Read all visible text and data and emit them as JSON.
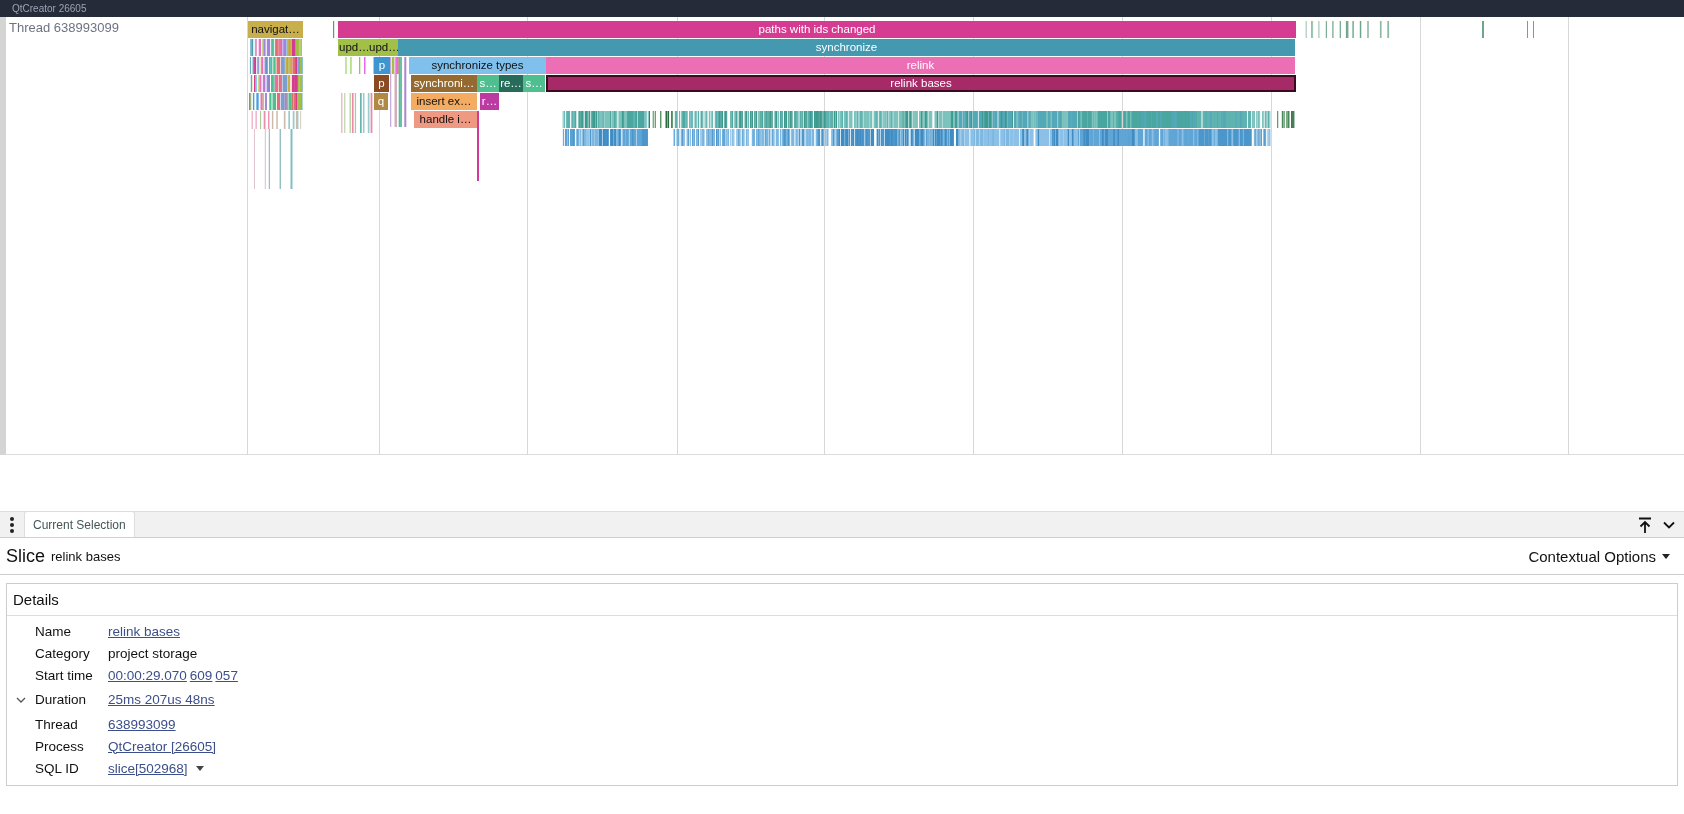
{
  "window": {
    "title": "QtCreator 26605"
  },
  "track": {
    "title": "Thread 638993099",
    "slices": [
      {
        "label": "navigat…",
        "color": "#c8af4b",
        "selected": false
      },
      {
        "label": "paths with ids changed",
        "color": "#d63b92",
        "selected": false
      },
      {
        "label": "upd…",
        "color": "#a2bf48",
        "selected": false
      },
      {
        "label": "upd…",
        "color": "#a2bf48",
        "selected": false
      },
      {
        "label": "synchronize",
        "color": "#4499b0",
        "selected": false
      },
      {
        "label": "p",
        "color": "#3d96cf",
        "selected": false
      },
      {
        "label": "synchronize types",
        "color": "#80c0ec",
        "selected": false
      },
      {
        "label": "relink",
        "color": "#ec6fb6",
        "selected": false
      },
      {
        "label": "p",
        "color": "#8a4a22",
        "selected": false
      },
      {
        "label": "synchroni…",
        "color": "#946a30",
        "selected": false
      },
      {
        "label": "s…",
        "color": "#4fbf90",
        "selected": false
      },
      {
        "label": "re…",
        "color": "#276b5a",
        "selected": false
      },
      {
        "label": "s…",
        "color": "#4fbf90",
        "selected": false
      },
      {
        "label": "relink bases",
        "color": "#a62a68",
        "selected": true
      },
      {
        "label": "q",
        "color": "#b08a44",
        "selected": false
      },
      {
        "label": "insert ex…",
        "color": "#f4ab62",
        "selected": false
      },
      {
        "label": "r…",
        "color": "#bb3ba2",
        "selected": false
      },
      {
        "label": "handle i…",
        "color": "#ef9882",
        "selected": false
      }
    ]
  },
  "panel": {
    "tabs": [
      {
        "label": "Current Selection",
        "selected": true
      }
    ],
    "header": {
      "type": "Slice",
      "name": "relink bases",
      "options": "Contextual Options"
    },
    "details": {
      "title": "Details",
      "rows": [
        {
          "label": "Name",
          "kind": "link",
          "values": [
            "relink bases"
          ]
        },
        {
          "label": "Category",
          "kind": "text",
          "values": [
            "project storage"
          ]
        },
        {
          "label": "Start time",
          "kind": "link",
          "values": [
            "00:00:29.070",
            "609",
            "057"
          ]
        },
        {
          "label": "Duration",
          "kind": "expander",
          "expanded": true,
          "values": [
            "25ms 207us 48ns"
          ]
        },
        {
          "label": "Thread",
          "kind": "link",
          "values": [
            "638993099"
          ]
        },
        {
          "label": "Process",
          "kind": "link",
          "values": [
            "QtCreator [26605]"
          ]
        },
        {
          "label": "SQL ID",
          "kind": "menu",
          "values": [
            "slice[502968]"
          ]
        }
      ]
    }
  }
}
